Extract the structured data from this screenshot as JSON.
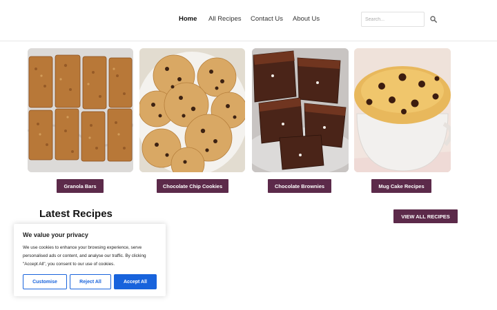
{
  "nav": {
    "home": "Home",
    "all_recipes": "All Recipes",
    "contact": "Contact Us",
    "about": "About Us"
  },
  "search": {
    "placeholder": "Search..."
  },
  "categories": [
    {
      "label": "Granola Bars"
    },
    {
      "label": "Chocolate Chip Cookies"
    },
    {
      "label": "Chocolate Brownies"
    },
    {
      "label": "Mug Cake Recipes"
    }
  ],
  "latest": {
    "title": "Latest Recipes",
    "view_all": "VIEW ALL RECIPES"
  },
  "cookie": {
    "title": "We value your privacy",
    "text": "We use cookies to enhance your browsing experience, serve personalised ads or content, and analyse our traffic. By clicking \"Accept All\", you consent to our use of cookies.",
    "customise": "Customise",
    "reject": "Reject All",
    "accept": "Accept All"
  },
  "colors": {
    "accent": "#5c2a4a",
    "cookie_blue": "#1863dc"
  }
}
